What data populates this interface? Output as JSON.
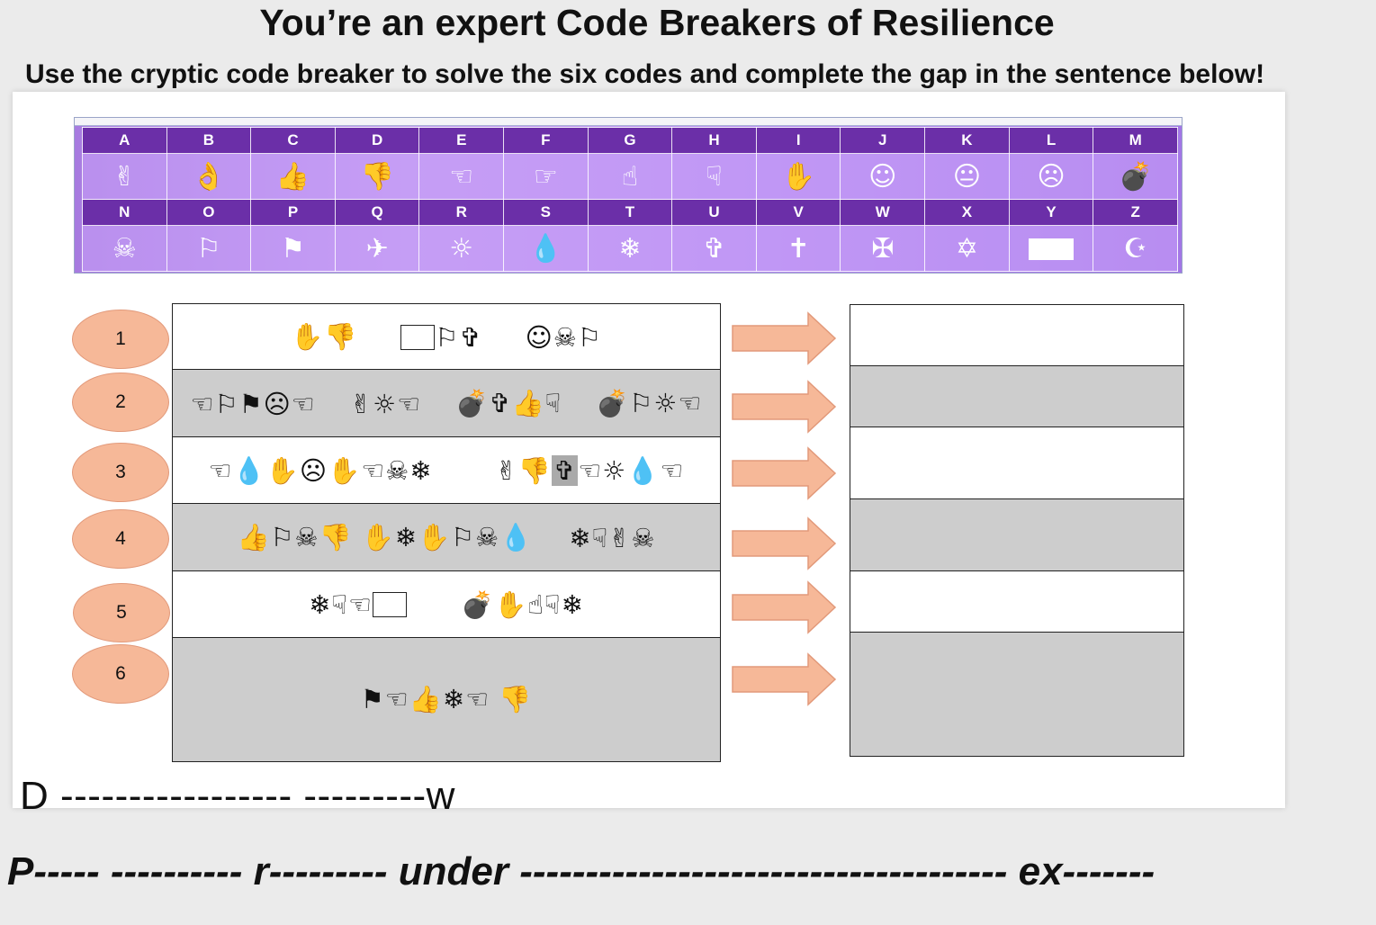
{
  "title": "You’re an expert Code Breakers of Resilience",
  "subtitle": "Use the cryptic code breaker to solve the six codes and complete the gap in the sentence below!",
  "cipher_key": {
    "row1_letters": [
      "A",
      "B",
      "C",
      "D",
      "E",
      "F",
      "G",
      "H",
      "I",
      "J",
      "K",
      "L",
      "M"
    ],
    "row1_symbols": [
      "✌",
      "👌",
      "👍",
      "👎",
      "☜",
      "☞",
      "☝",
      "☟",
      "✋",
      "☺",
      "😐",
      "☹",
      "💣"
    ],
    "row2_letters": [
      "N",
      "O",
      "P",
      "Q",
      "R",
      "S",
      "T",
      "U",
      "V",
      "W",
      "X",
      "Y",
      "Z"
    ],
    "row2_symbols": [
      "☠",
      "⚐",
      "⚑",
      "✈",
      "☼",
      "💧",
      "❄",
      "✞",
      "✝",
      "✠",
      "✡",
      "",
      "☪"
    ]
  },
  "codes": [
    {
      "number": "1",
      "part1": "✋👎",
      "part2": "⚐✞",
      "part3": "☺☠⚐"
    },
    {
      "number": "2",
      "part1": "☜⚐⚑☹☜",
      "part2": "✌☼☜",
      "part3": "💣✞👍☟",
      "part4": "💣⚐☼☜"
    },
    {
      "number": "3",
      "part1": "☜💧✋☹✋☜☠❄",
      "part2": "✌👎",
      "part3": "✞",
      "part4": "☜☼💧☜"
    },
    {
      "number": "4",
      "part1": "👍⚐☠👎",
      "part2": "✋❄✋⚐☠💧",
      "part3": "❄☟✌☠"
    },
    {
      "number": "5",
      "part1": "❄☟☜",
      "part2": "💣✋☝☟❄"
    },
    {
      "number": "6",
      "part1": "⚑☜👍❄☜",
      "part2": "👎"
    }
  ],
  "sentence_line1": "D ----------------- ---------w",
  "sentence_line2": "P----- ----------  r---------  under ------------------------------------- ex-------"
}
